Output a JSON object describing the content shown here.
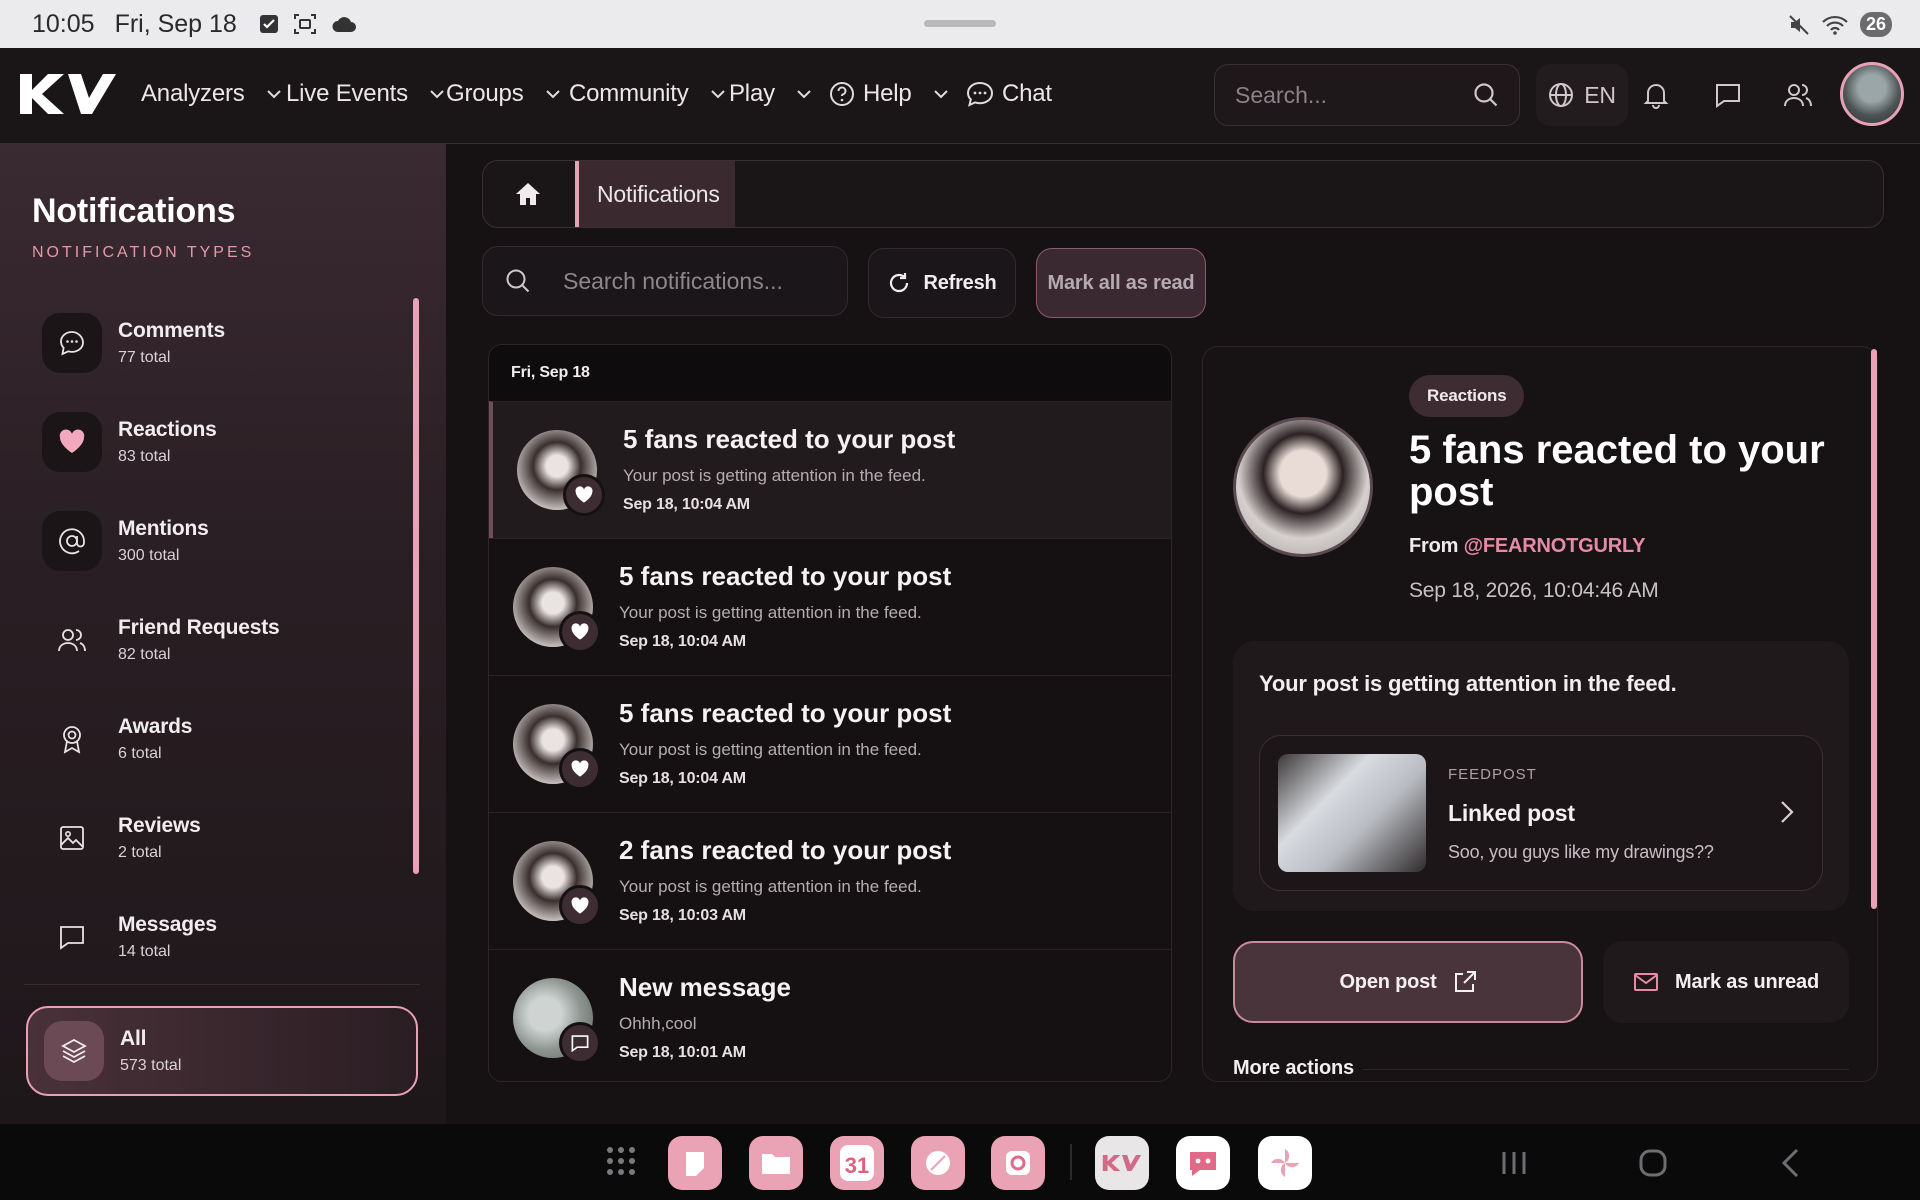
{
  "status_bar": {
    "time": "10:05",
    "date": "Fri, Sep 18",
    "battery": "26"
  },
  "nav": {
    "items": [
      "Analyzers",
      "Live Events",
      "Groups",
      "Community",
      "Play",
      "Help",
      "Chat"
    ],
    "search_placeholder": "Search...",
    "language": "EN"
  },
  "sidebar": {
    "title": "Notifications",
    "subtitle": "NOTIFICATION TYPES",
    "items": [
      {
        "label": "Comments",
        "count": "77 total",
        "icon": "comment-icon"
      },
      {
        "label": "Reactions",
        "count": "83 total",
        "icon": "heart-icon"
      },
      {
        "label": "Mentions",
        "count": "300 total",
        "icon": "at-icon"
      },
      {
        "label": "Friend Requests",
        "count": "82 total",
        "icon": "users-icon"
      },
      {
        "label": "Awards",
        "count": "6 total",
        "icon": "award-icon"
      },
      {
        "label": "Reviews",
        "count": "2 total",
        "icon": "image-icon"
      },
      {
        "label": "Messages",
        "count": "14 total",
        "icon": "message-icon"
      }
    ],
    "all": {
      "label": "All",
      "count": "573 total"
    }
  },
  "breadcrumb": {
    "current": "Notifications"
  },
  "toolbar": {
    "search_placeholder": "Search notifications...",
    "refresh_label": "Refresh",
    "mark_all_label": "Mark all as read"
  },
  "list": {
    "date_header": "Fri, Sep 18",
    "rows": [
      {
        "title": "5 fans reacted to your post",
        "desc": "Your post is getting attention in the feed.",
        "time": "Sep 18, 10:04 AM",
        "kind": "reaction"
      },
      {
        "title": "5 fans reacted to your post",
        "desc": "Your post is getting attention in the feed.",
        "time": "Sep 18, 10:04 AM",
        "kind": "reaction"
      },
      {
        "title": "5 fans reacted to your post",
        "desc": "Your post is getting attention in the feed.",
        "time": "Sep 18, 10:04 AM",
        "kind": "reaction"
      },
      {
        "title": "2 fans reacted to your post",
        "desc": "Your post is getting attention in the feed.",
        "time": "Sep 18, 10:03 AM",
        "kind": "reaction"
      },
      {
        "title": "New message",
        "desc": "Ohhh,cool",
        "time": "Sep 18, 10:01 AM",
        "kind": "message"
      }
    ]
  },
  "detail": {
    "tag": "Reactions",
    "title": "5 fans reacted to your post",
    "from_prefix": "From",
    "from_handle": "@FEARNOTGURLY",
    "date": "Sep 18, 2026, 10:04:46 AM",
    "body": "Your post is getting attention in the feed.",
    "linked": {
      "kind": "FEEDPOST",
      "title": "Linked post",
      "subtitle": "Soo, you guys like my drawings??"
    },
    "open_label": "Open post",
    "unread_label": "Mark as unread",
    "more_actions": "More actions"
  },
  "dock": {
    "calendar_day": "31"
  },
  "colors": {
    "accent": "#e6a2b4",
    "handle": "#e78aa5",
    "background": "#161214"
  }
}
